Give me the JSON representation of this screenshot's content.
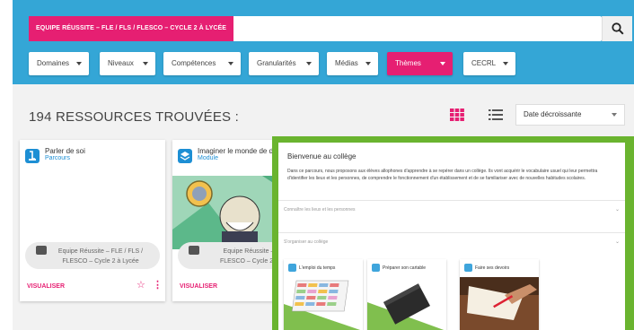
{
  "search": {
    "chip_label": "EQUIPE RÉUSSITE – FLE / FLS / FLESCO – CYCLE 2 À LYCÉE",
    "icon": "search-icon"
  },
  "filters": [
    {
      "label": "Domaines",
      "active": false
    },
    {
      "label": "Niveaux",
      "active": false
    },
    {
      "label": "Compétences",
      "active": false
    },
    {
      "label": "Granularités",
      "active": false
    },
    {
      "label": "Médias",
      "active": false
    },
    {
      "label": "Thèmes",
      "active": true
    },
    {
      "label": "CECRL",
      "active": false
    }
  ],
  "results": {
    "count_label": "194 RESSOURCES TROUVÉES :",
    "sort_value": "Date décroissante",
    "view_icons": [
      "grid-view-icon",
      "list-view-icon"
    ]
  },
  "cards": [
    {
      "title": "Parler de soi",
      "type": "Parcours",
      "author_line1": "Equipe Réussite – FLE / FLS /",
      "author_line2": "FLESCO – Cycle 2 à Lycée",
      "action": "VISUALISER"
    },
    {
      "title": "Imaginer le monde de de",
      "type": "Module",
      "author_line1": "Equipe Réussite – FL",
      "author_line2": "FLESCO – Cycle 2 à Ly",
      "action": "VISUALISER"
    }
  ],
  "overlay": {
    "title": "Bienvenue au collège",
    "description": "Dans ce parcours, nous proposons aux élèves allophones d'apprendre à se repérer dans un collège. Ils vont acquérir le vocabulaire usuel qui leur permettra d'identifier les lieux et les personnes, de comprendre le fonctionnement d'un établissement et de se familiariser avec de nouvelles habitudes scolaires.",
    "sections": [
      {
        "label": "Connaître les lieux et les personnes"
      },
      {
        "label": "S'organiser au collège"
      }
    ],
    "modules": [
      {
        "title": "L'emploi du temps"
      },
      {
        "title": "Préparer son cartable"
      },
      {
        "title": "Faire ses devoirs"
      }
    ]
  },
  "colors": {
    "header_blue": "#34a6d6",
    "accent_pink": "#e61f72",
    "overlay_green": "#6ab42f"
  }
}
